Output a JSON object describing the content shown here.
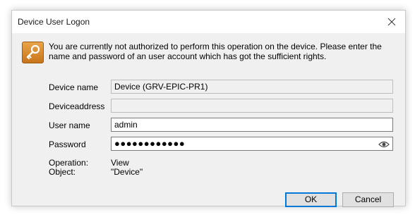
{
  "window": {
    "title": "Device User Logon",
    "close_label": "✕"
  },
  "message": {
    "text": "You are currently not authorized to perform this operation on the device. Please enter the name and password of an user account which has got the sufficient rights.",
    "icon": "key-icon"
  },
  "form": {
    "device_name": {
      "label": "Device name",
      "value": "Device (GRV-EPIC-PR1)"
    },
    "device_address": {
      "label": "Deviceaddress",
      "value": ""
    },
    "user_name": {
      "label": "User name",
      "value": "admin"
    },
    "password": {
      "label": "Password",
      "value": "●●●●●●●●●●●●",
      "toggle_icon": "eye-icon"
    }
  },
  "info": {
    "operation_label": "Operation:",
    "operation_value": "View",
    "object_label": "Object:",
    "object_value": "\"Device\""
  },
  "buttons": {
    "ok": "OK",
    "cancel": "Cancel"
  },
  "colors": {
    "accent": "#0078d7",
    "key_icon": "#d9852a",
    "dialog_bg": "#f0f0f0"
  }
}
